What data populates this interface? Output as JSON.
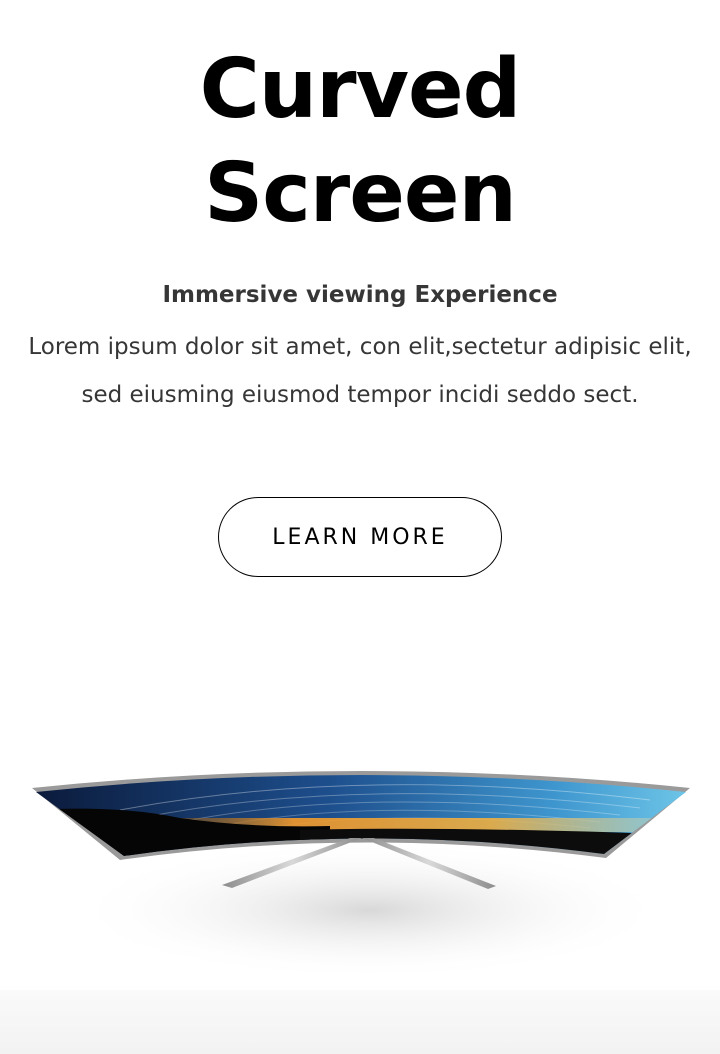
{
  "hero": {
    "title_line1": "Curved",
    "title_line2": "Screen",
    "subtitle": "Immersive viewing Experience",
    "body": "Lorem ipsum dolor sit amet, con elit,sectetur adipisic elit, sed eiusming  eiusmod tempor incidi seddo sect.",
    "cta_label": "LEARN MORE"
  },
  "image": {
    "subject": "curved-tv",
    "screen_colors": [
      "#0b1a3a",
      "#2a6fb0",
      "#6fc6e8",
      "#f39a2a",
      "#1b1b1b"
    ]
  }
}
